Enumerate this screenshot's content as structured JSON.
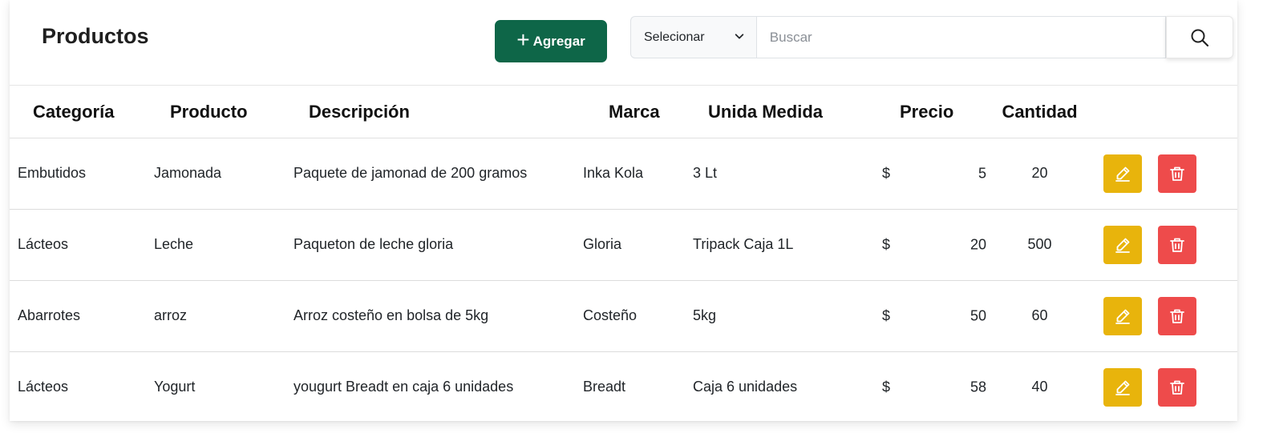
{
  "header": {
    "title": "Productos",
    "add_label": "Agregar",
    "select_value": "Selecionar",
    "search_placeholder": "Buscar"
  },
  "colors": {
    "add_button": "#0e6648",
    "edit_button": "#e8b40c",
    "delete_button": "#ee4b4b"
  },
  "table": {
    "columns": [
      "Categoría",
      "Producto",
      "Descripción",
      "Marca",
      "Unida Medida",
      "Precio",
      "Cantidad"
    ],
    "currency": "$",
    "rows": [
      {
        "categoria": "Embutidos",
        "producto": "Jamonada",
        "descripcion": "Paquete de jamonad de 200 gramos",
        "marca": "Inka Kola",
        "unidad": "3 Lt",
        "precio": "5",
        "cantidad": "20"
      },
      {
        "categoria": "Lácteos",
        "producto": "Leche",
        "descripcion": "Paqueton de leche gloria",
        "marca": "Gloria",
        "unidad": "Tripack Caja 1L",
        "precio": "20",
        "cantidad": "500"
      },
      {
        "categoria": "Abarrotes",
        "producto": "arroz",
        "descripcion": "Arroz costeño en bolsa de 5kg",
        "marca": "Costeño",
        "unidad": "5kg",
        "precio": "50",
        "cantidad": "60"
      },
      {
        "categoria": "Lácteos",
        "producto": "Yogurt",
        "descripcion": "yougurt Breadt en caja 6 unidades",
        "marca": "Breadt",
        "unidad": "Caja 6 unidades",
        "precio": "58",
        "cantidad": "40"
      }
    ]
  },
  "icons": {
    "add": "plus-icon",
    "select": "chevron-down-icon",
    "search": "search-icon",
    "edit": "edit-icon",
    "delete": "trash-icon"
  }
}
